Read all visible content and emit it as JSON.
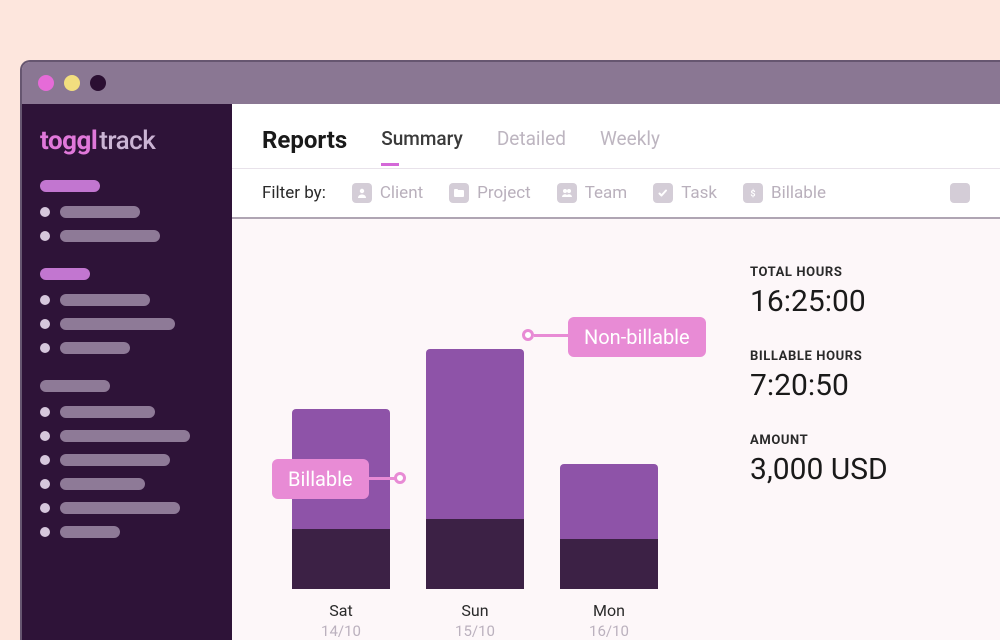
{
  "brand": {
    "toggl": "toggl",
    "track": "track"
  },
  "tabs": {
    "title": "Reports",
    "items": [
      {
        "label": "Summary",
        "active": true
      },
      {
        "label": "Detailed",
        "active": false
      },
      {
        "label": "Weekly",
        "active": false
      }
    ]
  },
  "filters": {
    "label": "Filter by:",
    "items": [
      {
        "label": "Client",
        "icon": "person-icon"
      },
      {
        "label": "Project",
        "icon": "folder-icon"
      },
      {
        "label": "Team",
        "icon": "team-icon"
      },
      {
        "label": "Task",
        "icon": "check-icon"
      },
      {
        "label": "Billable",
        "icon": "dollar-icon"
      }
    ]
  },
  "callouts": {
    "nonbillable": "Non-billable",
    "billable": "Billable"
  },
  "chart_data": {
    "type": "bar",
    "categories": [
      "Sat",
      "Sun",
      "Mon"
    ],
    "dates": [
      "14/10",
      "15/10",
      "16/10"
    ],
    "series": [
      {
        "name": "Non-billable",
        "values": [
          120,
          170,
          75
        ]
      },
      {
        "name": "Billable",
        "values": [
          60,
          70,
          50
        ]
      }
    ],
    "title": "",
    "xlabel": "",
    "ylabel": "",
    "ylim": [
      0,
      260
    ]
  },
  "stats": {
    "total_hours": {
      "label": "TOTAL HOURS",
      "value": "16:25:00"
    },
    "billable_hours": {
      "label": "BILLABLE HOURS",
      "value": "7:20:50"
    },
    "amount": {
      "label": "AMOUNT",
      "value": "3,000 USD"
    }
  },
  "colors": {
    "accent_pink": "#E88BD5",
    "bar_upper": "#8E53A8",
    "bar_lower": "#3C2145",
    "sidebar_bg": "#2E1338"
  }
}
